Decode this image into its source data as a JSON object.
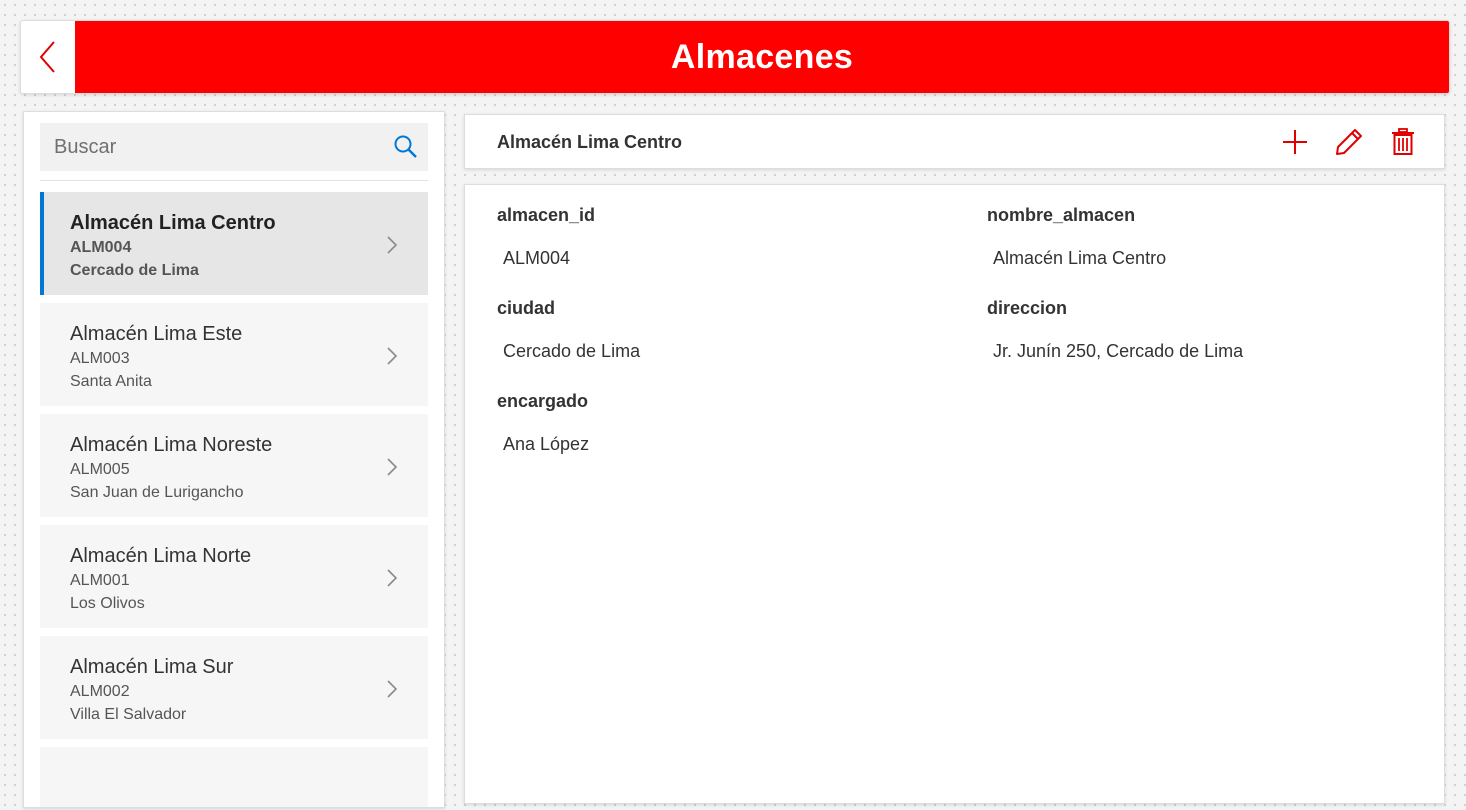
{
  "header": {
    "title": "Almacenes"
  },
  "search": {
    "placeholder": "Buscar"
  },
  "list": {
    "items": [
      {
        "name": "Almacén Lima Centro",
        "code": "ALM004",
        "city": "Cercado de Lima"
      },
      {
        "name": "Almacén Lima Este",
        "code": "ALM003",
        "city": "Santa Anita"
      },
      {
        "name": "Almacén Lima Noreste",
        "code": "ALM005",
        "city": "San Juan de Lurigancho"
      },
      {
        "name": "Almacén Lima Norte",
        "code": "ALM001",
        "city": "Los Olivos"
      },
      {
        "name": "Almacén Lima Sur",
        "code": "ALM002",
        "city": "Villa El Salvador"
      }
    ],
    "selected_index": 0
  },
  "detail": {
    "title": "Almacén Lima Centro",
    "fields": {
      "almacen_id": {
        "label": "almacen_id",
        "value": "ALM004"
      },
      "nombre_almacen": {
        "label": "nombre_almacen",
        "value": "Almacén Lima Centro"
      },
      "ciudad": {
        "label": "ciudad",
        "value": "Cercado de Lima"
      },
      "direccion": {
        "label": "direccion",
        "value": "Jr. Junín 250, Cercado de Lima"
      },
      "encargado": {
        "label": "encargado",
        "value": "Ana López"
      }
    }
  },
  "icons": {
    "back": "chevron-left-icon",
    "search": "search-icon",
    "add": "plus-icon",
    "edit": "pencil-icon",
    "delete": "trash-icon",
    "row": "chevron-right-icon"
  },
  "colors": {
    "brand_red": "#ff0000",
    "selection_accent": "#0078d4",
    "search_icon": "#0078d4"
  }
}
